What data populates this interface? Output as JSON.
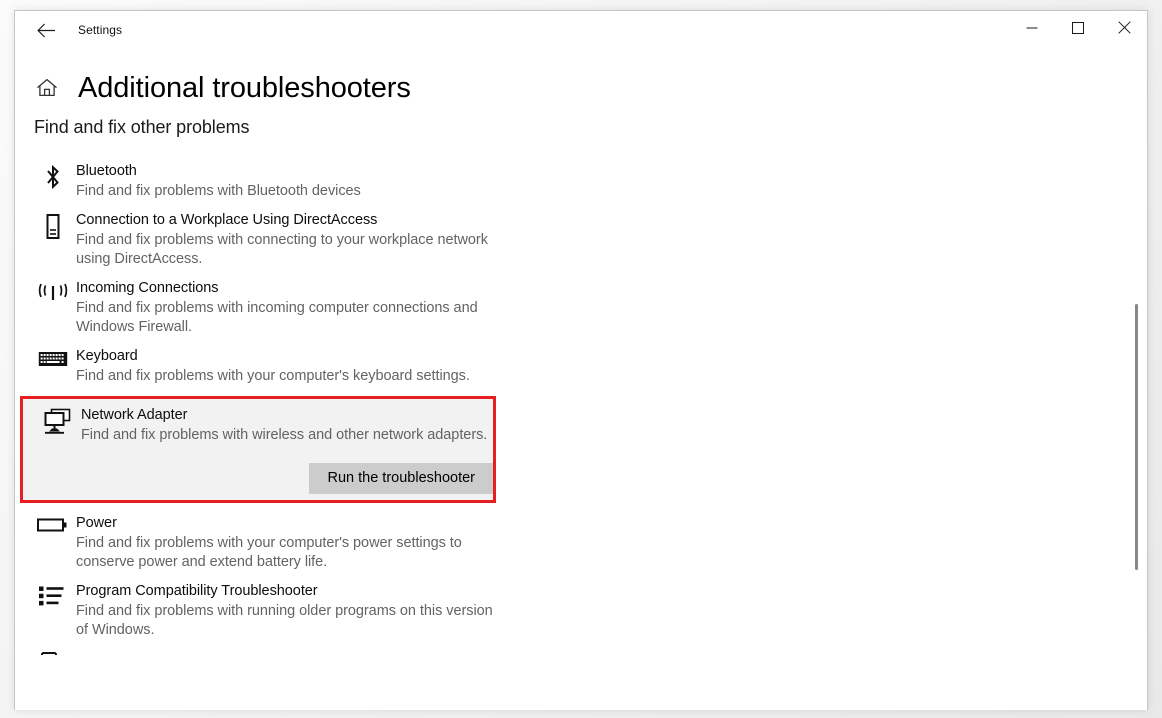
{
  "window": {
    "app_title": "Settings",
    "back_icon": "back-arrow-icon",
    "controls": {
      "minimize": "minimize-icon",
      "maximize": "maximize-icon",
      "close": "close-icon"
    }
  },
  "header": {
    "home_icon": "home-icon",
    "title": "Additional troubleshooters",
    "subtitle": "Find and fix other problems"
  },
  "troubleshooters": [
    {
      "icon": "bluetooth-icon",
      "name": "Bluetooth",
      "description": "Find and fix problems with Bluetooth devices",
      "selected": false
    },
    {
      "icon": "workplace-device-icon",
      "name": "Connection to a Workplace Using DirectAccess",
      "description": "Find and fix problems with connecting to your workplace network using DirectAccess.",
      "selected": false
    },
    {
      "icon": "incoming-connections-icon",
      "name": "Incoming Connections",
      "description": "Find and fix problems with incoming computer connections and Windows Firewall.",
      "selected": false
    },
    {
      "icon": "keyboard-icon",
      "name": "Keyboard",
      "description": "Find and fix problems with your computer's keyboard settings.",
      "selected": false
    },
    {
      "icon": "network-adapter-icon",
      "name": "Network Adapter",
      "description": "Find and fix problems with wireless and other network adapters.",
      "selected": true,
      "button_label": "Run the troubleshooter"
    },
    {
      "icon": "battery-icon",
      "name": "Power",
      "description": "Find and fix problems with your computer's power settings to conserve power and extend battery life.",
      "selected": false
    },
    {
      "icon": "program-list-icon",
      "name": "Program Compatibility Troubleshooter",
      "description": "Find and fix problems with running older programs on this version of Windows.",
      "selected": false
    }
  ],
  "colors": {
    "highlight_border": "#e81f20",
    "selected_background": "#f2f2f2",
    "button_background": "#cccccc",
    "description_text": "#636363"
  },
  "scrollbar": {
    "name": "vertical-scrollbar"
  }
}
